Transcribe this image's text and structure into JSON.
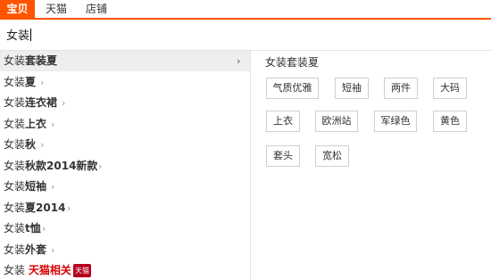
{
  "tabs": [
    {
      "label": "宝贝",
      "active": true
    },
    {
      "label": "天猫",
      "active": false
    },
    {
      "label": "店铺",
      "active": false
    }
  ],
  "search": {
    "value": "女装"
  },
  "suggestions": [
    {
      "prefix": "女装",
      "rest": "套装夏"
    },
    {
      "prefix": "女装",
      "rest": "夏"
    },
    {
      "prefix": "女装",
      "rest": "连衣裙"
    },
    {
      "prefix": "女装",
      "rest": "上衣"
    },
    {
      "prefix": "女装",
      "rest": "秋"
    },
    {
      "prefix": "女装",
      "rest": "秋款2014新款"
    },
    {
      "prefix": "女装",
      "rest": "短袖"
    },
    {
      "prefix": "女装",
      "rest": "夏2014"
    },
    {
      "prefix": "女装",
      "rest": "t恤"
    },
    {
      "prefix": "女装",
      "rest": "外套"
    }
  ],
  "tmall_row": {
    "prefix": "女装",
    "label": "天猫相关",
    "badge": "天猫"
  },
  "chevron": "›",
  "detail": {
    "title": "女装套装夏",
    "tags": [
      "气质优雅",
      "短袖",
      "两件",
      "大码",
      "上衣",
      "欧洲站",
      "军绿色",
      "黄色",
      "套头",
      "宽松"
    ]
  },
  "colors": {
    "accent": "#ff5500",
    "tmall": "#b5001d"
  }
}
